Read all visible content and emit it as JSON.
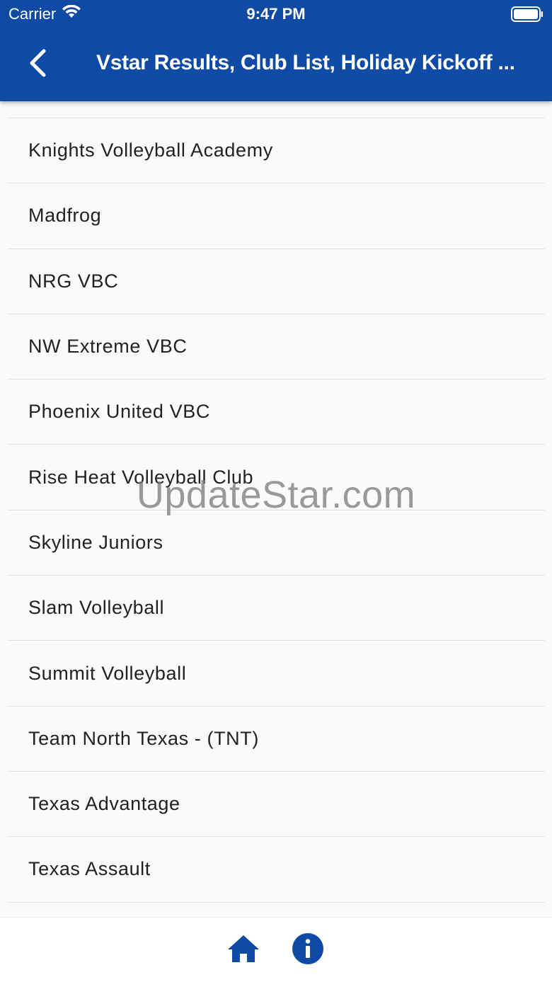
{
  "status_bar": {
    "carrier": "Carrier",
    "time": "9:47 PM"
  },
  "nav": {
    "title": "Vstar Results, Club List, Holiday Kickoff ..."
  },
  "clubs": [
    "Knights Volleyball Academy",
    "Madfrog",
    "NRG VBC",
    "NW Extreme VBC",
    "Phoenix United VBC",
    "Rise Heat Volleyball Club",
    "Skyline Juniors",
    "Slam Volleyball",
    "Summit Volleyball",
    "Team North Texas - (TNT)",
    "Texas Advantage",
    "Texas Assault"
  ],
  "watermark": "UpdateStar.com",
  "colors": {
    "header": "#0f4aa5",
    "accent": "#0f4aa5"
  },
  "icons": {
    "back": "chevron-left-icon",
    "home": "home-icon",
    "info": "info-icon"
  }
}
